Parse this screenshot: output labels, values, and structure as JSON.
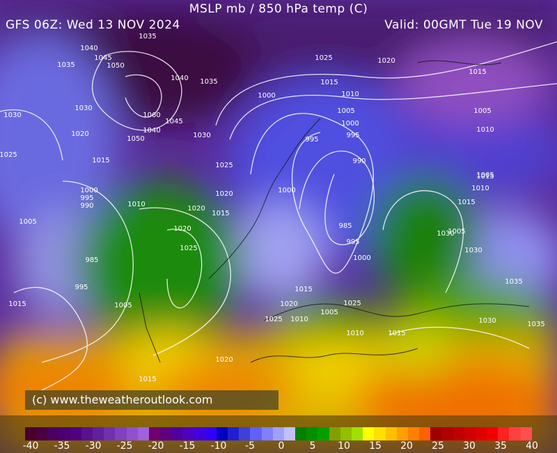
{
  "header": {
    "title": "MSLP mb / 850 hPa temp (C)",
    "run": "GFS 06Z: Wed 13 NOV 2024",
    "valid": "Valid: 00GMT Tue 19 NOV"
  },
  "credit": "(c) www.theweatheroutlook.com",
  "isobar_labels": [
    "1035",
    "1040",
    "1045",
    "1050",
    "1035",
    "1030",
    "1030",
    "1025",
    "1020",
    "1015",
    "1060",
    "1045",
    "1040",
    "1040",
    "1050",
    "1035",
    "1030",
    "1025",
    "1020",
    "1000",
    "1015",
    "1010",
    "1025",
    "1020",
    "1005",
    "1000",
    "995",
    "995",
    "990",
    "1015",
    "1005",
    "1010",
    "1015",
    "1005",
    "1020",
    "1000",
    "995",
    "990",
    "1010",
    "1005",
    "1015",
    "1020",
    "1025",
    "1000",
    "985",
    "995",
    "1000",
    "1015",
    "1020",
    "1025",
    "1030",
    "1035",
    "985",
    "995",
    "1015",
    "1005",
    "1010",
    "1020",
    "1015",
    "1025",
    "1010",
    "1005",
    "1005",
    "1015",
    "1010",
    "1030",
    "1030",
    "1035",
    "1015"
  ],
  "colorbar": {
    "labels": [
      "-40",
      "-35",
      "-30",
      "-25",
      "-20",
      "-15",
      "-10",
      "-5",
      "0",
      "5",
      "10",
      "15",
      "20",
      "25",
      "30",
      "35",
      "40"
    ],
    "colors": [
      "#4a0028",
      "#4a0040",
      "#4a0060",
      "#4a0070",
      "#500080",
      "#5a1090",
      "#6020a0",
      "#7030b0",
      "#8040c0",
      "#9050d0",
      "#a060e0",
      "#700070",
      "#600080",
      "#5000a0",
      "#5000c0",
      "#4000e0",
      "#3000ff",
      "#0000c0",
      "#2020d0",
      "#4040d8",
      "#6060ff",
      "#8080ff",
      "#a0a0ff",
      "#c0c0ff",
      "#008000",
      "#009000",
      "#00a000",
      "#80a000",
      "#90c000",
      "#a0e000",
      "#ffff00",
      "#ffe000",
      "#ffc000",
      "#ffa000",
      "#ff8000",
      "#ff6000",
      "#a00000",
      "#b00000",
      "#c00000",
      "#d00000",
      "#e00000",
      "#f00000",
      "#ff2020",
      "#ff4040",
      "#ff5050"
    ]
  },
  "colors": {
    "cold": "#5a2aa8",
    "cool": "#7070e0",
    "mild": "#1a8a10",
    "warm": "#f0c000",
    "hot": "#f08000"
  }
}
